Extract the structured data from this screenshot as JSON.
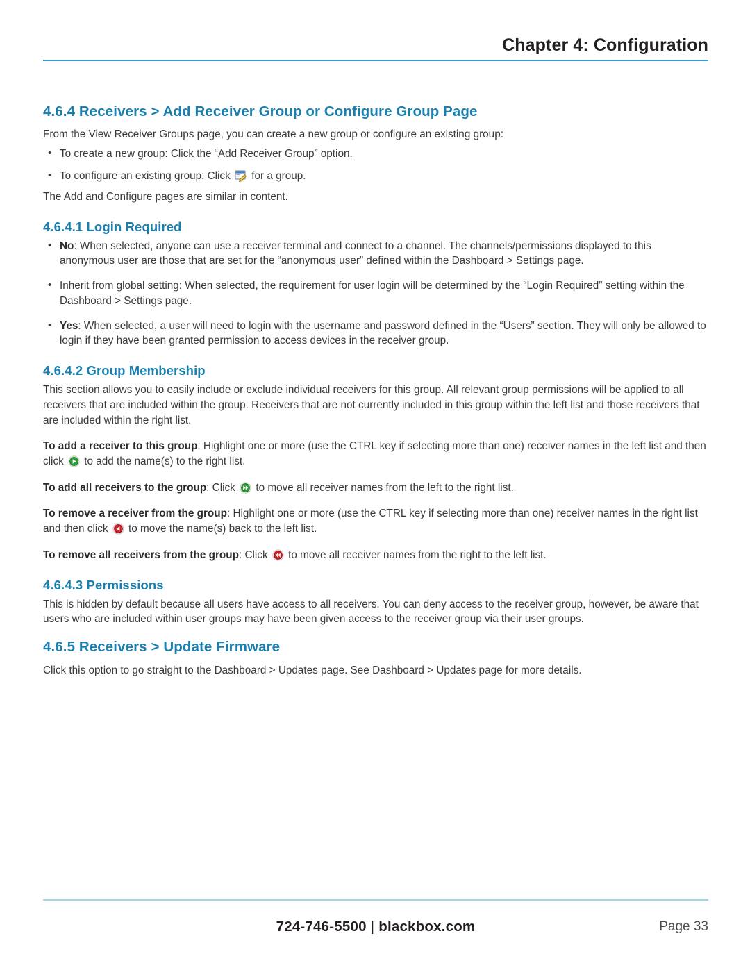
{
  "header": {
    "chapter_title": "Chapter 4: Configuration",
    "rule_color": "#3b9dc9"
  },
  "heading_color": "#1a7faf",
  "sections": {
    "s464": {
      "heading": "4.6.4 Receivers > Add Receiver Group or Configure Group Page",
      "intro": "From the View Receiver Groups page, you can create a new group or configure an existing group:",
      "bullet1": "To create a new group: Click the “Add Receiver Group” option.",
      "bullet2_pre": "To configure an existing group: Click",
      "bullet2_post": "for a group.",
      "closing": "The Add and Configure pages are similar in content."
    },
    "s4641": {
      "heading": "4.6.4.1 Login Required",
      "bullets": [
        {
          "lead": "No",
          "rest": ": When selected, anyone can use a receiver terminal and connect to a channel. The channels/permissions displayed to this anonymous user are those that are set for the “anonymous user” defined within the Dashboard > Settings page."
        },
        {
          "lead": "",
          "rest": "Inherit from global setting: When selected, the requirement for user login will be determined by the “Login Required” setting within the Dashboard > Settings page."
        },
        {
          "lead": "Yes",
          "rest": ": When selected, a user will need to login with the username and password defined in the “Users” section. They will only be allowed to login if they have been granted permission to access devices in the receiver group."
        }
      ]
    },
    "s4642": {
      "heading": "4.6.4.2 Group Membership",
      "intro": "This section allows you to easily include or exclude individual receivers for this group. All relevant group permissions will be applied to all receivers that are included within the group. Receivers that are not currently included in this group within the left list and those receivers that are included within the right list.",
      "instructions": [
        {
          "lead": "To add a receiver to this group",
          "mid": ": Highlight one or more (use the CTRL key if selecting more than one) receiver names in the left list and then click",
          "icon": "arrow-right-green-icon",
          "tail": "to add the name(s) to the right list."
        },
        {
          "lead": "To add all receivers to the group",
          "mid": ": Click",
          "icon": "double-arrow-right-green-icon",
          "tail": "to move all receiver names from the left to the right list."
        },
        {
          "lead": "To remove a receiver from the group",
          "mid": ": Highlight one or more (use the CTRL key if selecting more than one) receiver names in the right list and then click",
          "icon": "arrow-left-red-icon",
          "tail": "to move the name(s) back to the left list."
        },
        {
          "lead": "To remove all receivers from the group",
          "mid": ": Click",
          "icon": "double-arrow-left-red-icon",
          "tail": "to move all receiver names from the right to the left list."
        }
      ]
    },
    "s4643": {
      "heading": "4.6.4.3 Permissions",
      "body": "This is hidden by default because all users have access to all receivers. You can deny access to the receiver group, however, be aware that users who are included within user groups may have been given access to the receiver group via their user groups."
    },
    "s465": {
      "heading": "4.6.5 Receivers > Update Firmware",
      "body": "Click this option to go straight to the Dashboard > Updates page. See Dashboard > Updates page for more details."
    }
  },
  "icons": {
    "configure": "configure-edit-icon",
    "green": "#1f9d3a",
    "red": "#d2232a"
  },
  "footer": {
    "phone": "724-746-5500",
    "separator": "|",
    "site": "blackbox.com",
    "page": "Page 33",
    "rule_color": "#9ad6e6"
  }
}
